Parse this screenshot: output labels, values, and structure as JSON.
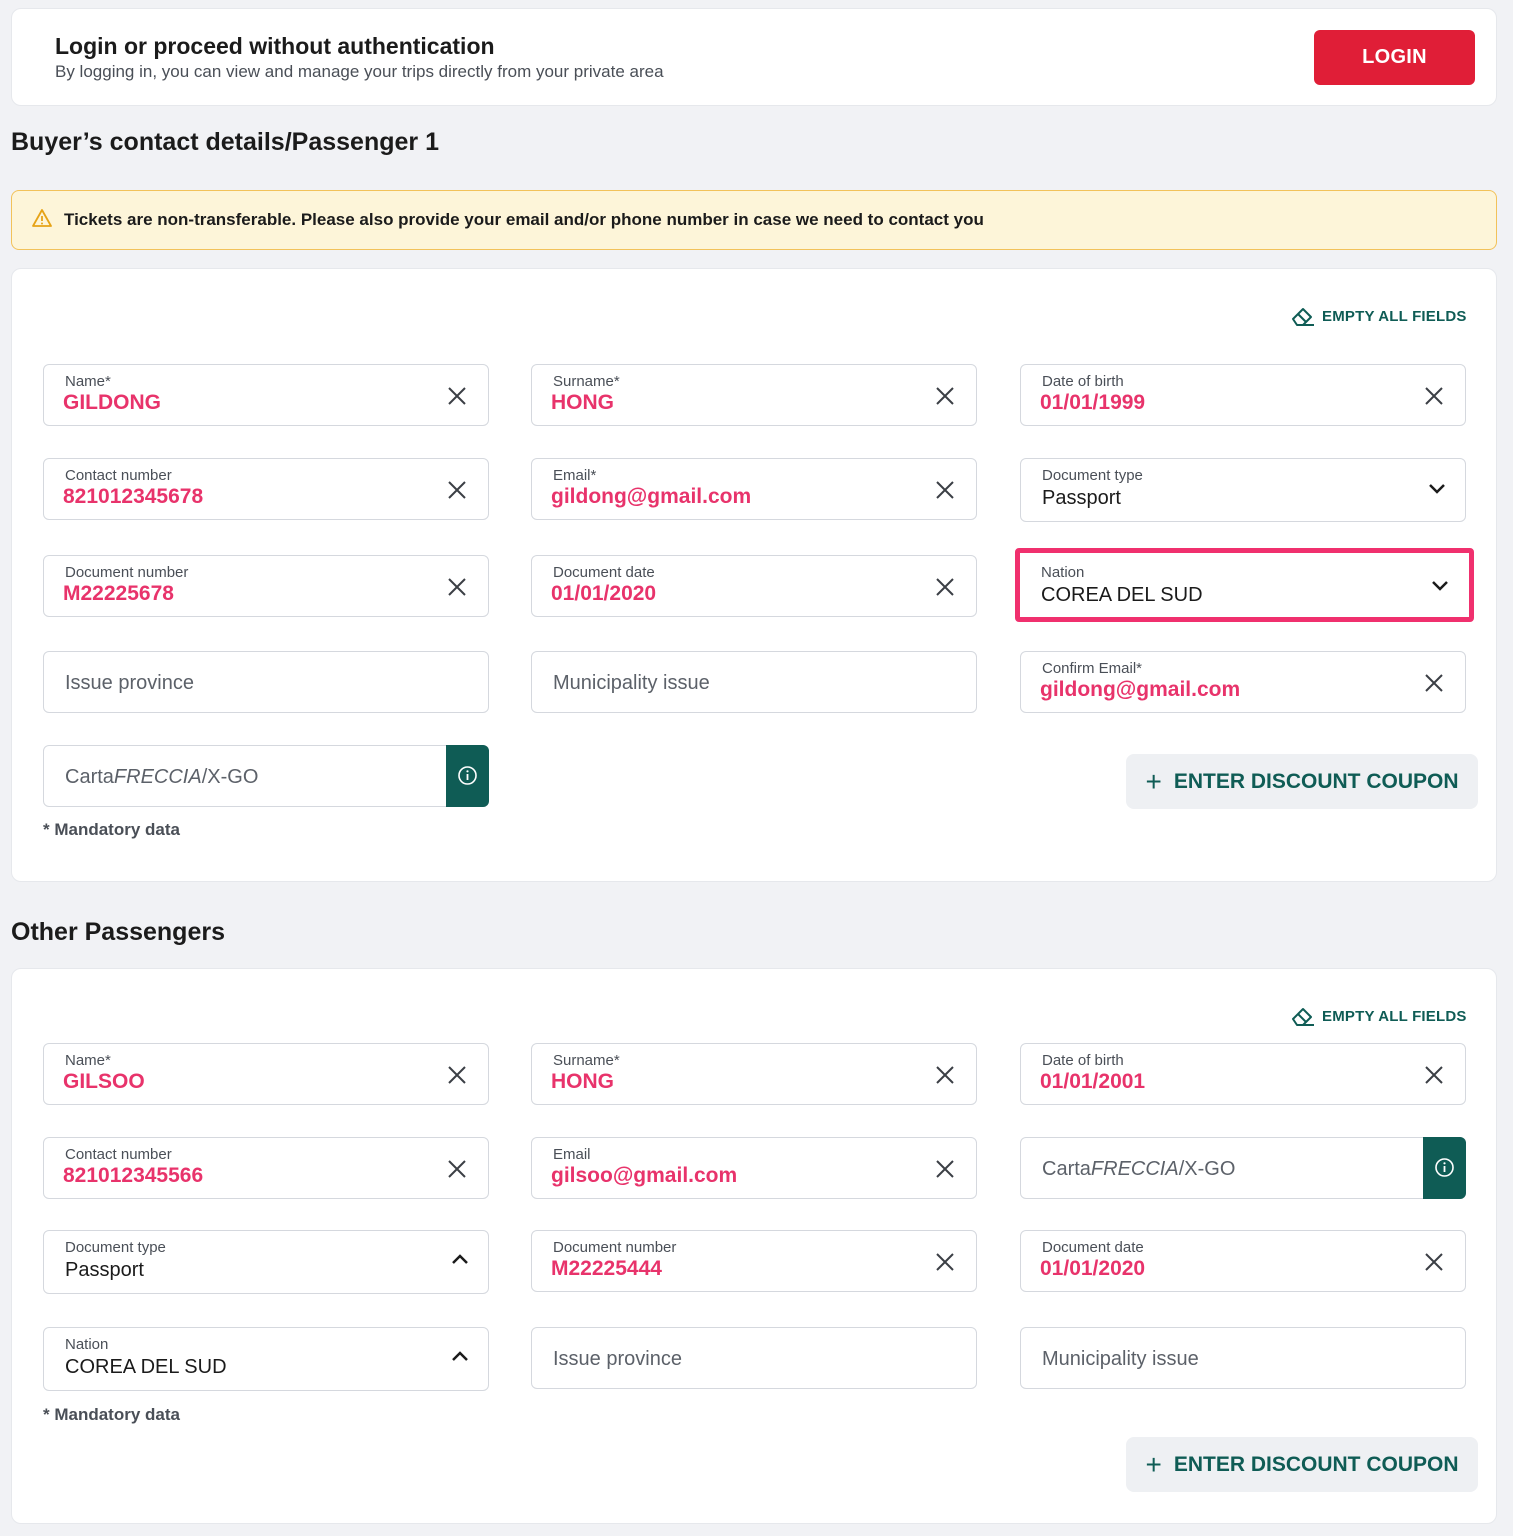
{
  "login": {
    "title": "Login or proceed without authentication",
    "subtitle": "By logging in, you can view and manage your trips directly from your private area",
    "button": "LOGIN"
  },
  "passenger1": {
    "title": "Buyer’s contact details/Passenger 1",
    "warning": "Tickets are non-transferable. Please also provide your email and/or phone number in case we need to contact you",
    "empty_all": "EMPTY ALL FIELDS",
    "name": {
      "label": "Name*",
      "value": "GILDONG"
    },
    "surname": {
      "label": "Surname*",
      "value": "HONG"
    },
    "dob": {
      "label": "Date of birth",
      "value": "01/01/1999"
    },
    "contact": {
      "label": "Contact number",
      "value": "821012345678"
    },
    "email": {
      "label": "Email*",
      "value": "gildong@gmail.com"
    },
    "doc_type": {
      "label": "Document type",
      "value": "Passport"
    },
    "doc_number": {
      "label": "Document number",
      "value": "M22225678"
    },
    "doc_date": {
      "label": "Document date",
      "value": "01/01/2020"
    },
    "nation": {
      "label": "Nation",
      "value": "COREA DEL SUD"
    },
    "issue_province": {
      "placeholder": "Issue province"
    },
    "municipality": {
      "placeholder": "Municipality issue"
    },
    "confirm_email": {
      "label": "Confirm Email*",
      "value": "gildong@gmail.com"
    },
    "carta": {
      "prefix": "Carta",
      "italic": "FRECCIA",
      "suffix": "/X-GO"
    },
    "mandatory": "* Mandatory data",
    "coupon": "ENTER DISCOUNT COUPON"
  },
  "passenger2": {
    "title": "Other Passengers",
    "empty_all": "EMPTY ALL FIELDS",
    "name": {
      "label": "Name*",
      "value": "GILSOO"
    },
    "surname": {
      "label": "Surname*",
      "value": "HONG"
    },
    "dob": {
      "label": "Date of birth",
      "value": "01/01/2001"
    },
    "contact": {
      "label": "Contact number",
      "value": "821012345566"
    },
    "email": {
      "label": "Email",
      "value": "gilsoo@gmail.com"
    },
    "carta": {
      "prefix": "Carta",
      "italic": "FRECCIA",
      "suffix": "/X-GO"
    },
    "doc_type": {
      "label": "Document type",
      "value": "Passport"
    },
    "doc_number": {
      "label": "Document number",
      "value": "M22225444"
    },
    "doc_date": {
      "label": "Document date",
      "value": "01/01/2020"
    },
    "nation": {
      "label": "Nation",
      "value": "COREA DEL SUD"
    },
    "issue_province": {
      "placeholder": "Issue province"
    },
    "municipality": {
      "placeholder": "Municipality issue"
    },
    "mandatory": "* Mandatory data",
    "coupon": "ENTER DISCOUNT COUPON"
  },
  "colors": {
    "accent": "#0f5c55",
    "login_red": "#e01e37",
    "highlight_pink": "#f0306e",
    "warning_bg": "#fdf5d9"
  }
}
